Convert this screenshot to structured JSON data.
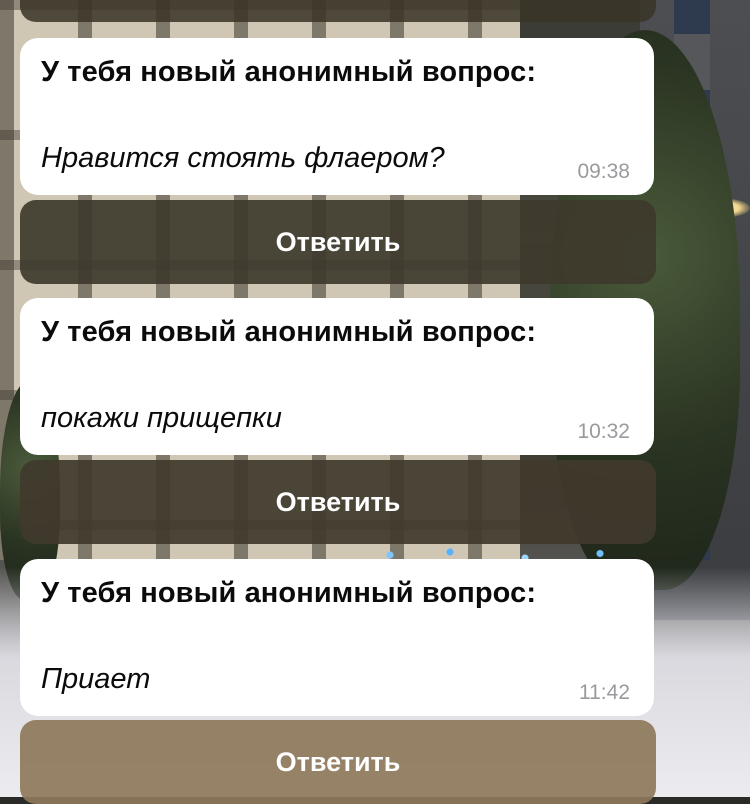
{
  "messages": [
    {
      "heading": "У тебя новый анонимный вопрос:",
      "question": "Нравится стоять флаером?",
      "time": "09:38",
      "reply_label": "Ответить"
    },
    {
      "heading": "У тебя новый анонимный вопрос:",
      "question": "покажи прищепки",
      "time": "10:32",
      "reply_label": "Ответить"
    },
    {
      "heading": "У тебя новый анонимный вопрос:",
      "question": "Приает",
      "time": "11:42",
      "reply_label": "Ответить"
    }
  ],
  "colors": {
    "bubble_background": "#ffffff",
    "text_primary": "#0b0b0b",
    "timestamp": "#9a9a9e",
    "reply_button_text": "#ffffff"
  }
}
